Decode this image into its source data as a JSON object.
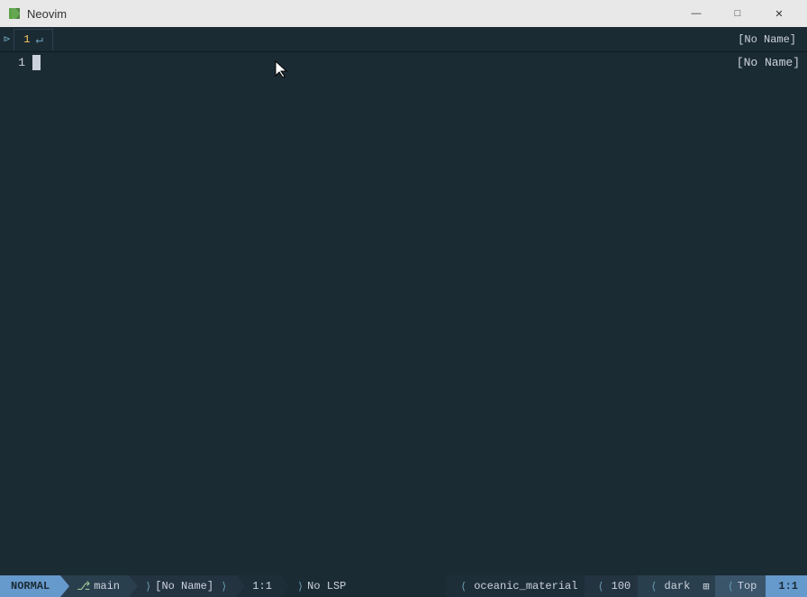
{
  "titlebar": {
    "title": "Neovim",
    "minimize_label": "—",
    "maximize_label": "□",
    "close_label": "✕"
  },
  "tabbar": {
    "arrow": "⊳",
    "tab_number": "1",
    "tab_modified_icon": "↵",
    "tab_name_right": "[No Name]"
  },
  "editor": {
    "line_number": "1",
    "no_name_label": "[No Name]"
  },
  "statusbar": {
    "mode": "NORMAL",
    "git_icon": "",
    "git_branch": "main",
    "filename_arrow": "⟩",
    "filename": "[No Name]",
    "filename_arrow2": "⟩",
    "position": "1:1",
    "position_arrow": "⟩",
    "lsp_arrow": "⟩",
    "lsp": "No LSP",
    "theme": "oceanic_material",
    "theme_arrow_left": "⟨",
    "percent": "100",
    "percent_arrow_left": "⟨",
    "darkmode": "dark",
    "darkmode_arrow_left": "⟨",
    "os_icon": "⊞",
    "top_arrow_left": "⟨",
    "top": "Top",
    "rowcol": "1:1"
  },
  "colors": {
    "bg": "#1b2b34",
    "accent_blue": "#6699cc",
    "accent_teal": "#6a9fb5",
    "accent_green": "#99c794",
    "text_main": "#cdd3de",
    "text_dim": "#4e6374",
    "status_bg1": "#2a3f4e",
    "status_bg2": "#243340",
    "status_bg3": "#1e2e38",
    "status_top_bg": "#3a546a"
  }
}
